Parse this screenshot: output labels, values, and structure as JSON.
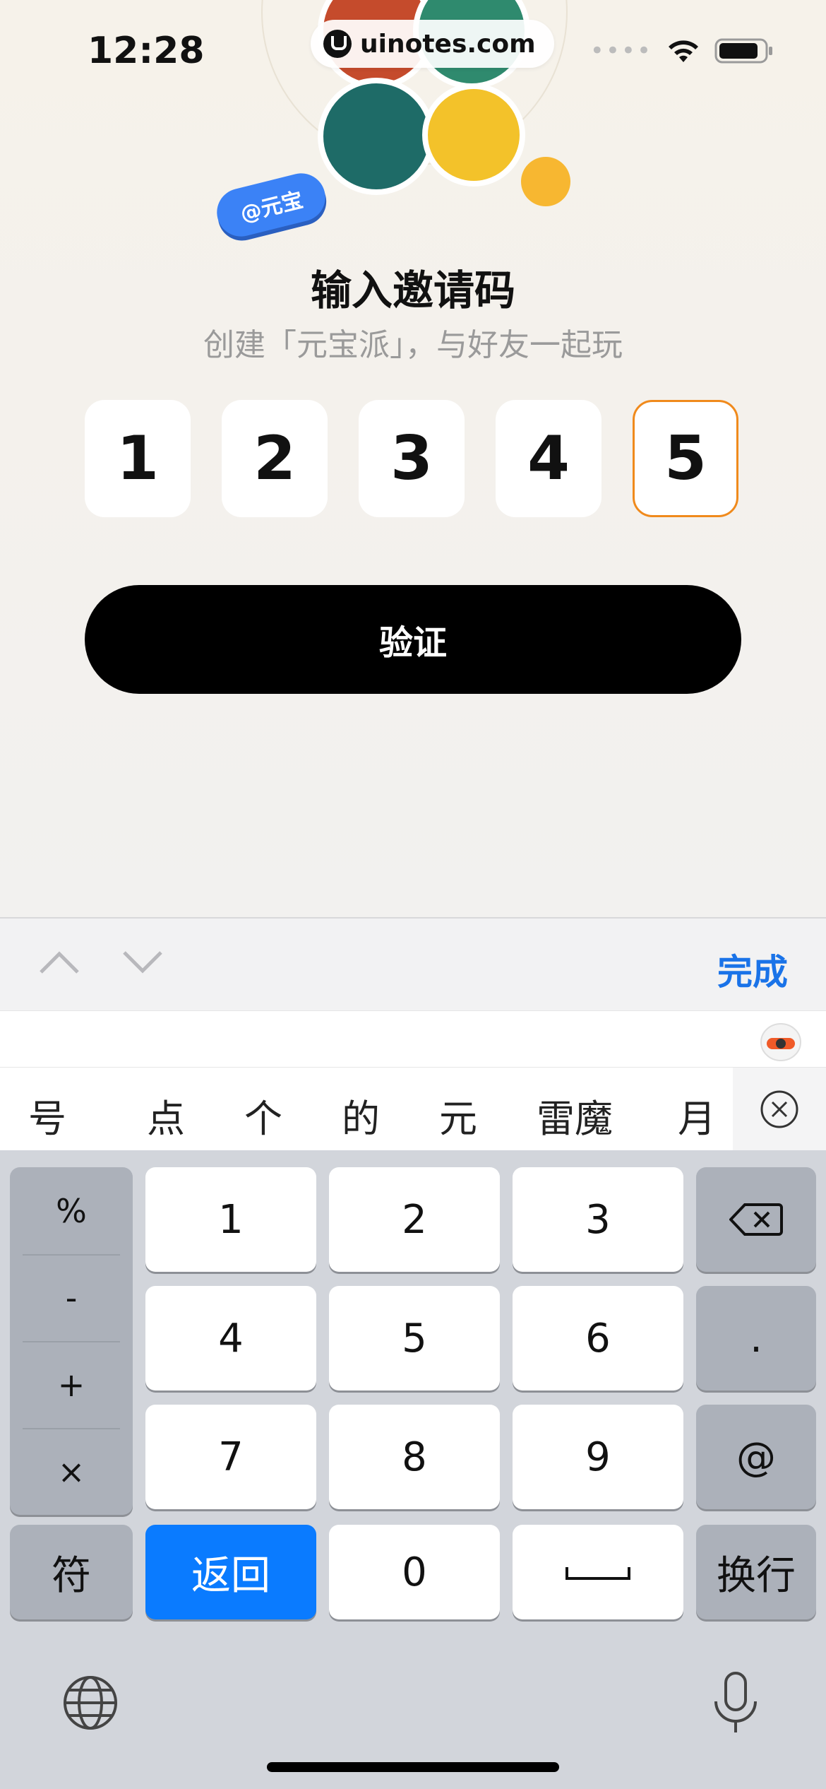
{
  "status": {
    "time": "12:28",
    "url": "uinotes.com"
  },
  "header": {
    "tag": "@元宝",
    "title": "输入邀请码",
    "subtitle": "创建「元宝派」，与好友一起玩"
  },
  "code": {
    "digits": [
      "1",
      "2",
      "3",
      "4",
      "5"
    ],
    "active_index": 4
  },
  "verify_label": "验证",
  "toolbar": {
    "done_label": "完成"
  },
  "candidates": [
    "号",
    "点",
    "个",
    "的",
    "元",
    "雷魔",
    "月"
  ],
  "keyboard": {
    "symbols": [
      "%",
      "-",
      "+",
      "×"
    ],
    "digits": [
      "1",
      "2",
      "3",
      "4",
      "5",
      "6",
      "7",
      "8",
      "9"
    ],
    "period": ".",
    "at": "@",
    "fu": "符",
    "return": "返回",
    "zero": "0",
    "newline": "换行"
  },
  "colors": {
    "accent": "#0a7bff",
    "active_border": "#f08a1c",
    "done": "#1a73e8"
  }
}
